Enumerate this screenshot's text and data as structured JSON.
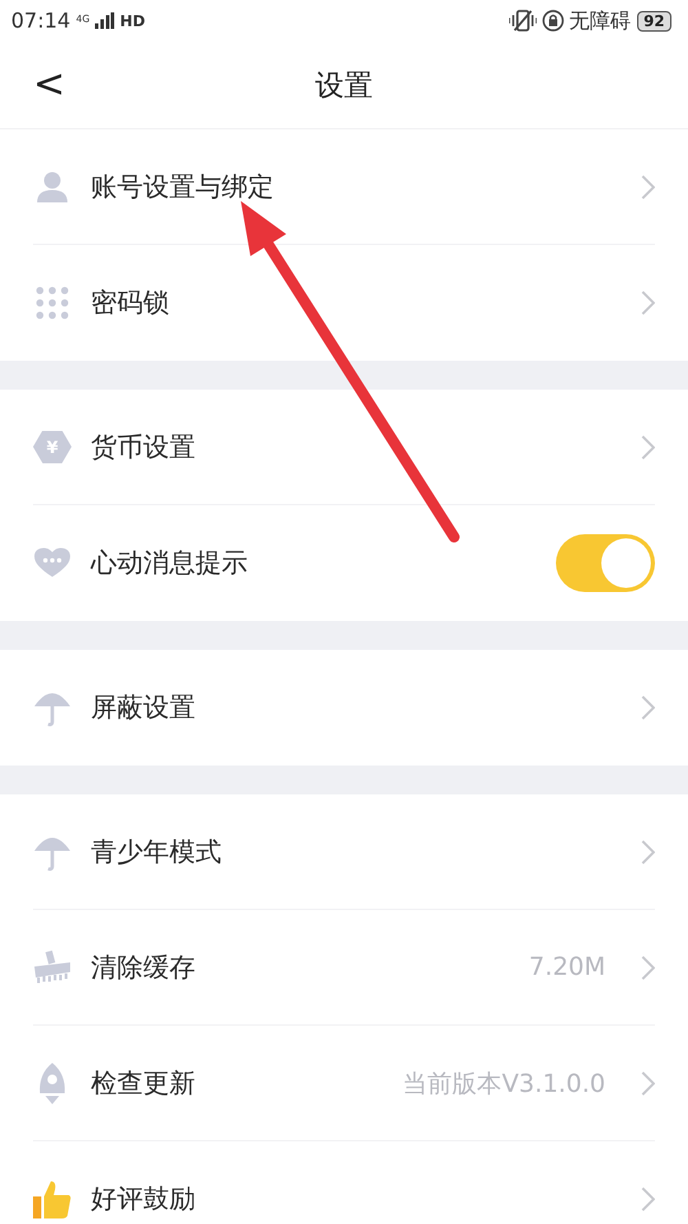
{
  "status_bar": {
    "time": "07:14",
    "network": "4G",
    "hd": "HD",
    "accessibility": "无障碍",
    "battery": "92"
  },
  "header": {
    "back": "<",
    "title": "设置"
  },
  "groups": [
    {
      "items": [
        {
          "kind": "link",
          "label": "账号设置与绑定"
        },
        {
          "kind": "link",
          "label": "密码锁"
        }
      ]
    },
    {
      "items": [
        {
          "kind": "link",
          "label": "货币设置",
          "icon_glyph": "¥"
        },
        {
          "kind": "toggle",
          "label": "心动消息提示",
          "on": true
        }
      ]
    },
    {
      "items": [
        {
          "kind": "link",
          "label": "屏蔽设置"
        }
      ]
    },
    {
      "items": [
        {
          "kind": "link",
          "label": "青少年模式"
        },
        {
          "kind": "link",
          "label": "清除缓存",
          "value": "7.20M"
        },
        {
          "kind": "link",
          "label": "检查更新",
          "value": "当前版本V3.1.0.0"
        },
        {
          "kind": "link",
          "label": "好评鼓励"
        }
      ]
    }
  ]
}
